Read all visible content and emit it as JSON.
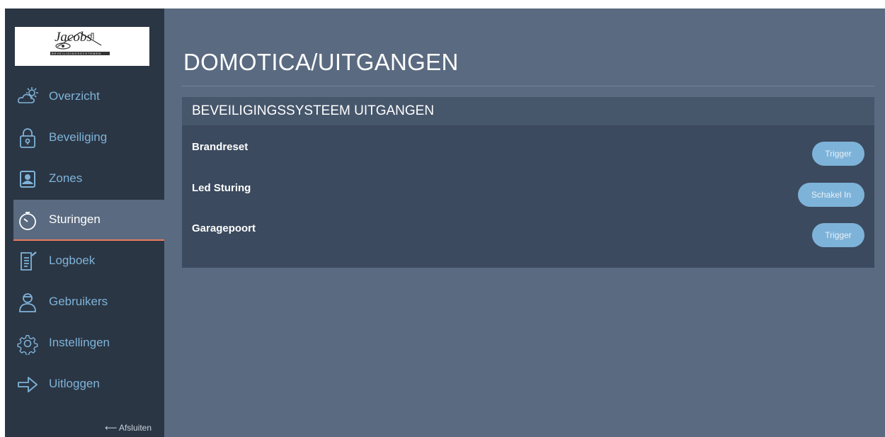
{
  "brand": {
    "logo_text": "Jacobs",
    "logo_tagline": "BEVEILIGINGSSYSTEMEN"
  },
  "sidebar": {
    "items": [
      {
        "label": "Overzicht",
        "icon": "cloud-sun-icon"
      },
      {
        "label": "Beveiliging",
        "icon": "lock-icon"
      },
      {
        "label": "Zones",
        "icon": "zone-icon"
      },
      {
        "label": "Sturingen",
        "icon": "stopwatch-icon",
        "active": true
      },
      {
        "label": "Logboek",
        "icon": "document-edit-icon"
      },
      {
        "label": "Gebruikers",
        "icon": "user-icon"
      },
      {
        "label": "Instellingen",
        "icon": "gear-icon"
      },
      {
        "label": "Uitloggen",
        "icon": "arrow-right-icon"
      }
    ],
    "close_label": "⟵ Afsluiten"
  },
  "main": {
    "title": "DOMOTICA/UITGANGEN",
    "panel": {
      "title": "BEVEILIGINGSSYSTEEM UITGANGEN",
      "rows": [
        {
          "name": "Brandreset",
          "button": "Trigger"
        },
        {
          "name": "Led Sturing",
          "button": "Schakel In"
        },
        {
          "name": "Garagepoort",
          "button": "Trigger"
        }
      ]
    }
  },
  "colors": {
    "sidebar_bg": "#2b3644",
    "main_bg": "#5a6a80",
    "panel_bg": "#3b4a5e",
    "accent": "#7eb3d9",
    "active_underline": "#e97a5f"
  }
}
